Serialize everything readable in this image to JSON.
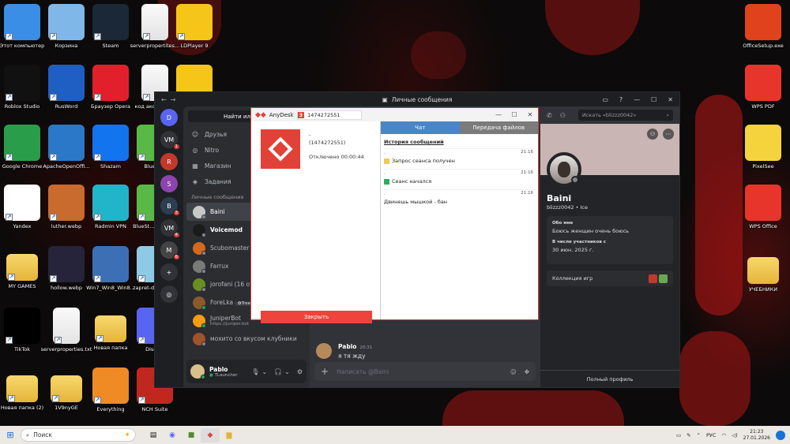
{
  "desktop": {
    "left_icons": [
      {
        "label": "Этот компьютер",
        "icon": "computer-icon",
        "color": "#3a8ee6"
      },
      {
        "label": "Корзина",
        "icon": "recycle-bin-icon",
        "color": "#7fb7e8"
      },
      {
        "label": "Steam",
        "icon": "steam-icon",
        "color": "#1b2838"
      },
      {
        "label": "serverpropertites...",
        "icon": "document-icon",
        "color": "#f3f3f3"
      },
      {
        "label": "LDPlayer 9",
        "icon": "ldplayer-icon",
        "color": "#f5c518"
      },
      {
        "label": "Roblox Studio",
        "icon": "roblox-icon",
        "color": "#111111"
      },
      {
        "label": "RusWord",
        "icon": "rusword-icon",
        "color": "#1f5fc4"
      },
      {
        "label": "Браузер Opera",
        "icon": "opera-icon",
        "color": "#e2202c"
      },
      {
        "label": "код аксессуа...",
        "icon": "document-icon",
        "color": "#f3f3f3"
      },
      {
        "label": "",
        "icon": "app-icon",
        "color": "#f5c518"
      },
      {
        "label": "Google Chrome",
        "icon": "chrome-icon",
        "color": "#2a9d4b"
      },
      {
        "label": "ApacheOpenOffi...",
        "icon": "openoffice-icon",
        "color": "#2b78c9"
      },
      {
        "label": "Shazam",
        "icon": "shazam-icon",
        "color": "#1274ef"
      },
      {
        "label": "BlueSt...",
        "icon": "bluestacks-icon",
        "color": "#58b947"
      },
      {
        "label": "Yandex",
        "icon": "yandex-icon",
        "color": "#ffffff"
      },
      {
        "label": "luther.webp",
        "icon": "image-icon",
        "color": "#c96a2e"
      },
      {
        "label": "Radmin VPN",
        "icon": "radmin-icon",
        "color": "#22b5c9"
      },
      {
        "label": "BlueSt... Multi-I...",
        "icon": "bluestacks-icon",
        "color": "#58b947"
      },
      {
        "label": "MY GAMES",
        "icon": "folder-icon",
        "color": "#f2c94c"
      },
      {
        "label": "hollow.webp",
        "icon": "image-icon",
        "color": "#26243a"
      },
      {
        "label": "Win7_Win8_Win8...",
        "icon": "installer-icon",
        "color": "#3d6fb5"
      },
      {
        "label": "zapret-dis... (2)...",
        "icon": "file-icon",
        "color": "#8ecae6"
      },
      {
        "label": "TikTok",
        "icon": "tiktok-icon",
        "color": "#000000"
      },
      {
        "label": "serverproperties.txt",
        "icon": "document-icon",
        "color": "#f3f3f3"
      },
      {
        "label": "Новая папка",
        "icon": "folder-icon",
        "color": "#f2c94c"
      },
      {
        "label": "Disco...",
        "icon": "discord-icon",
        "color": "#5865f2"
      },
      {
        "label": "Новая папка (2)",
        "icon": "folder-icon",
        "color": "#f2c94c"
      },
      {
        "label": "1V9nyGE",
        "icon": "folder-icon",
        "color": "#f2c94c"
      },
      {
        "label": "Everything",
        "icon": "everything-icon",
        "color": "#f08a24"
      },
      {
        "label": "NCH Suite",
        "icon": "nch-icon",
        "color": "#c0281f"
      }
    ],
    "right_icons": [
      {
        "label": "OfficeSetup.exe",
        "icon": "office-icon",
        "color": "#e0431c"
      },
      {
        "label": "WPS PDF",
        "icon": "wps-pdf-icon",
        "color": "#e8352c"
      },
      {
        "label": "PixelSee",
        "icon": "pixelsee-icon",
        "color": "#f5d33c"
      },
      {
        "label": "WPS Office",
        "icon": "wps-office-icon",
        "color": "#e8352c"
      },
      {
        "label": "УЧЕБНИКИ",
        "icon": "folder-icon",
        "color": "#f2c94c"
      }
    ]
  },
  "discord": {
    "window_title": "Личные сообщения",
    "find_button": "Найти или нача",
    "nav": [
      {
        "label": "Друзья",
        "icon": "friends-icon"
      },
      {
        "label": "Nitro",
        "icon": "nitro-icon"
      },
      {
        "label": "Магазин",
        "icon": "shop-icon"
      },
      {
        "label": "Задания",
        "icon": "quests-icon"
      }
    ],
    "dm_section_title": "Личные сообщения",
    "dms": [
      {
        "name": "Baini",
        "sub": "",
        "color": "#c8c8c8",
        "online": false,
        "active": true,
        "bold": false
      },
      {
        "name": "Voicemod",
        "sub": "",
        "color": "#1b1b1b",
        "online": false,
        "active": false,
        "bold": true
      },
      {
        "name": "Scubomaster",
        "sub": "",
        "color": "#d2691e",
        "online": false,
        "active": false,
        "bold": false
      },
      {
        "name": "Farrux",
        "sub": "",
        "color": "#7a7a7a",
        "online": false,
        "active": false,
        "bold": false
      },
      {
        "name": "jorofani (16 отзы",
        "sub": "",
        "color": "#6b8e23",
        "online": false,
        "active": false,
        "bold": false
      },
      {
        "name": "ForeLka",
        "sub": "",
        "color": "#8b5a2b",
        "online": true,
        "active": false,
        "bold": false,
        "tag": "Tree"
      },
      {
        "name": "JuniperBot",
        "sub": "https://juniper.bot",
        "color": "#f39c12",
        "online": true,
        "active": false,
        "bold": false
      },
      {
        "name": "мохито со вкусом клубники",
        "sub": "",
        "color": "#a0522d",
        "online": false,
        "active": false,
        "bold": false
      }
    ],
    "servers": [
      {
        "label": "D",
        "color": "#5865f2",
        "badge": ""
      },
      {
        "label": "VM",
        "color": "#313338",
        "badge": "1"
      },
      {
        "label": "R",
        "color": "#c0392b",
        "badge": ""
      },
      {
        "label": "S",
        "color": "#8e44ad",
        "badge": ""
      },
      {
        "label": "B",
        "color": "#2c3e50",
        "badge": "3"
      },
      {
        "label": "VM",
        "color": "#313338",
        "badge": "4"
      },
      {
        "label": "M",
        "color": "#444444",
        "badge": "6"
      },
      {
        "label": "+",
        "color": "#313338",
        "badge": ""
      },
      {
        "label": "◎",
        "color": "#313338",
        "badge": ""
      }
    ],
    "user": {
      "name": "Pablo",
      "status": "TLauncher"
    },
    "message": {
      "author": "Pablo",
      "time": "20:31",
      "text": "я тя жду"
    },
    "input_placeholder": "Написать @Baini",
    "search_placeholder": "Искать «blizzz0042»",
    "profile": {
      "name": "Baini",
      "handle": "blizzz0042 • Ice",
      "about_title": "Обо мне",
      "about_text": "Боюсь женщин очень боюсь",
      "member_since_title": "В числе участников с",
      "member_since": "30 июн. 2025 г.",
      "games_label": "Коллекция игр",
      "full_profile": "Полный профиль"
    }
  },
  "anydesk": {
    "title": "AnyDesk",
    "session_id": "1474272551",
    "session_number": "3",
    "remote_name": "-",
    "remote_id": "(1474272551)",
    "disconnected": "Отключено 00:00:44",
    "close_button": "Закрыть",
    "tab_chat": "Чат",
    "tab_files": "Передача файлов",
    "history_title": "История сообщений",
    "messages": [
      {
        "time": "21:16",
        "text": "Запрос сеанса получен",
        "icon": "warning-icon",
        "color": "#f2c94c"
      },
      {
        "time": "21:16",
        "text": "Сеанс начался",
        "icon": "check-icon",
        "color": "#27ae60"
      },
      {
        "time": "21:16",
        "text": "Двинешь мышкой - бан",
        "icon": "",
        "color": ""
      }
    ]
  },
  "taskbar": {
    "search_placeholder": "Поиск",
    "language": "РУС",
    "time": "21:23",
    "date": "27.01.2026"
  }
}
